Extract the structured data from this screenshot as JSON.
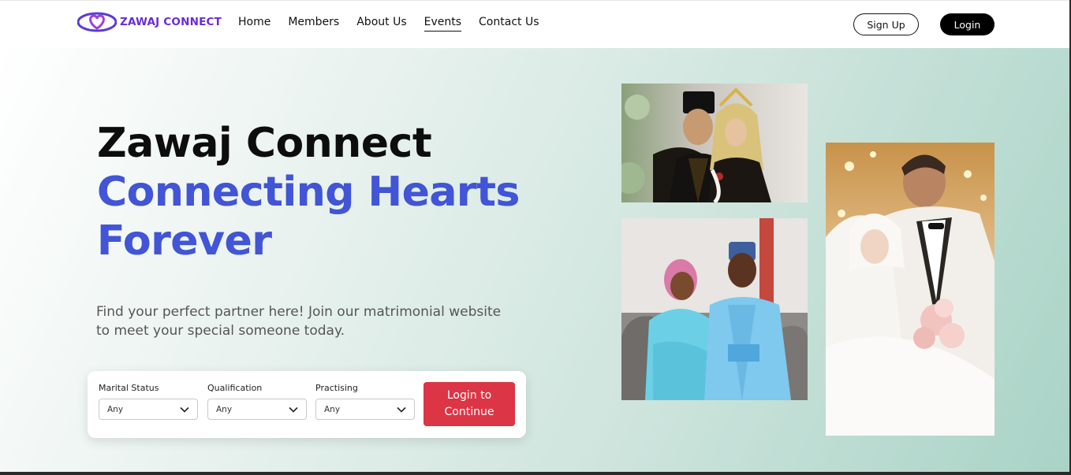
{
  "brand": {
    "name": "ZAWAJ CONNECT",
    "color": "#6a2bd9"
  },
  "nav": {
    "items": [
      {
        "label": "Home",
        "active": false
      },
      {
        "label": "Members",
        "active": false
      },
      {
        "label": "About Us",
        "active": false
      },
      {
        "label": "Events",
        "active": true
      },
      {
        "label": "Contact Us",
        "active": false
      }
    ],
    "signup_label": "Sign Up",
    "login_label": "Login"
  },
  "hero": {
    "title": "Zawaj Connect",
    "subtitle": "Connecting Hearts Forever",
    "description": "Find your perfect partner here! Join our matrimonial website to meet your special someone today.",
    "accent_color": "#4155d6"
  },
  "search": {
    "fields": [
      {
        "label": "Marital Status",
        "value": "Any"
      },
      {
        "label": "Qualification",
        "value": "Any"
      },
      {
        "label": "Practising",
        "value": "Any"
      }
    ],
    "submit_label": "Login to Continue",
    "submit_color": "#dc3545"
  },
  "photos": [
    {
      "name": "couple-traditional-photo"
    },
    {
      "name": "couple-blue-attire-photo"
    },
    {
      "name": "couple-white-wedding-photo"
    }
  ]
}
